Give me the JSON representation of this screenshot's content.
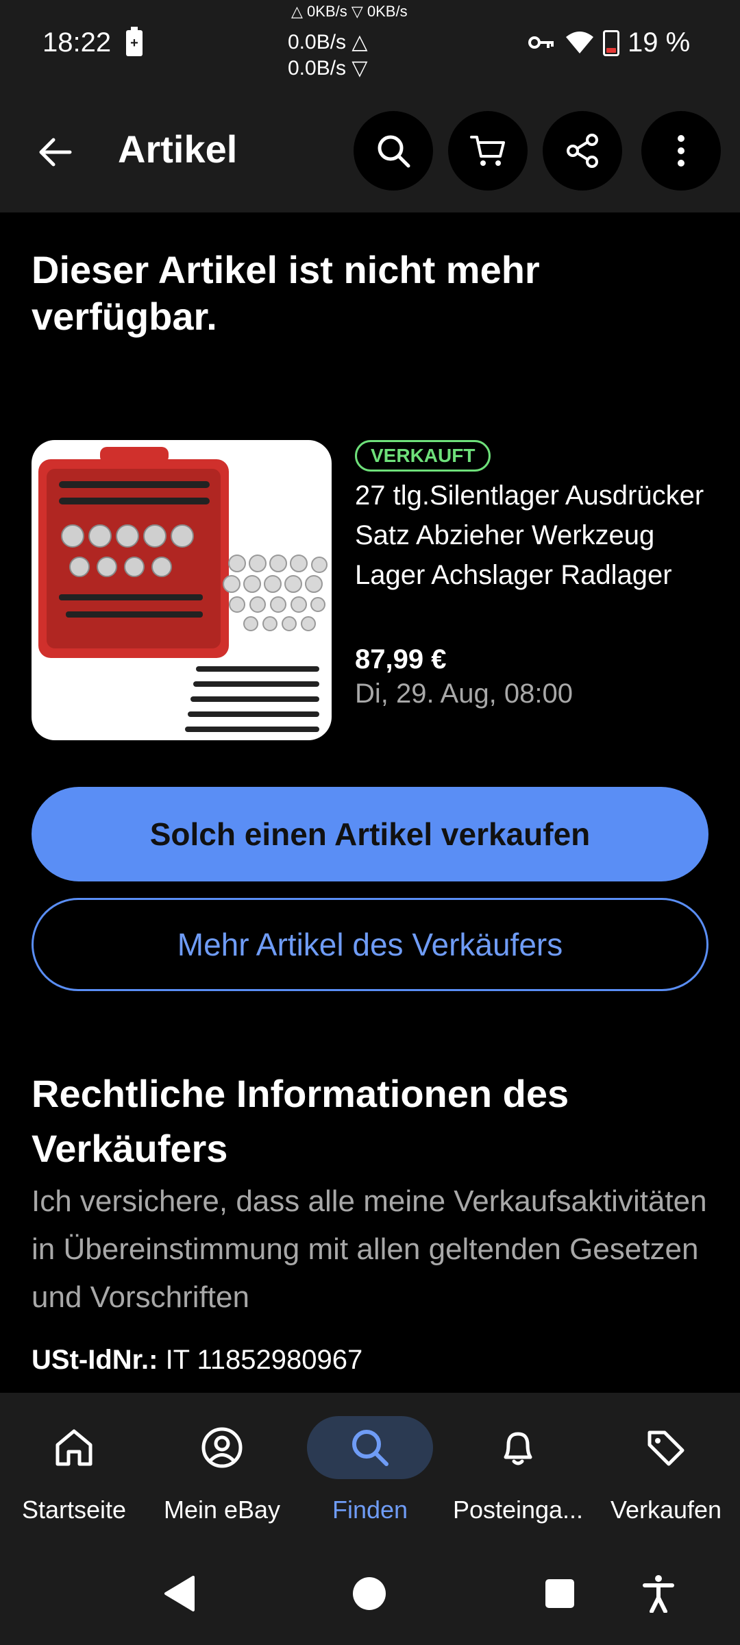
{
  "status_bar": {
    "time": "18:22",
    "net_top": "△ 0KB/s  ▽ 0KB/s",
    "net_up": "0.0B/s △",
    "net_down": "0.0B/s ▽",
    "battery_percent": "19 %",
    "battery_level": 0.19,
    "icons": [
      "charging-icon",
      "key-icon",
      "wifi-icon",
      "battery-icon"
    ]
  },
  "appbar": {
    "title": "Artikel",
    "actions": [
      "search-icon",
      "cart-icon",
      "share-icon",
      "more-icon"
    ]
  },
  "main": {
    "headline": "Dieser Artikel ist nicht mehr verfügbar.",
    "item": {
      "badge": "VERKAUFT",
      "title": "27 tlg.Silentlager Ausdrücker Satz Abzieher Werkzeug Lager Achslager Radlager",
      "price": "87,99 €",
      "date": "Di, 29. Aug, 08:00"
    },
    "primary_button": "Solch einen Artikel verkaufen",
    "secondary_button": "Mehr Artikel des Verkäufers",
    "legal": {
      "title": "Rechtliche Informationen des Verkäufers",
      "text": "Ich versichere, dass alle meine Verkaufsaktivitäten in Übereinstimmung mit allen geltenden Gesetzen und Vorschriften",
      "vat_label": "USt-IdNr.:",
      "vat_value": "IT 11852980967"
    }
  },
  "bottom_nav": {
    "items": [
      {
        "label": "Startseite",
        "icon": "home-icon"
      },
      {
        "label": "Mein eBay",
        "icon": "account-icon"
      },
      {
        "label": "Finden",
        "icon": "search-icon",
        "active": true
      },
      {
        "label": "Posteinga...",
        "icon": "bell-icon"
      },
      {
        "label": "Verkaufen",
        "icon": "tag-icon"
      }
    ]
  },
  "colors": {
    "accent": "#5a8ef5",
    "sold_green": "#6ee07a",
    "bar_bg": "#1c1c1c",
    "background": "#000000"
  }
}
